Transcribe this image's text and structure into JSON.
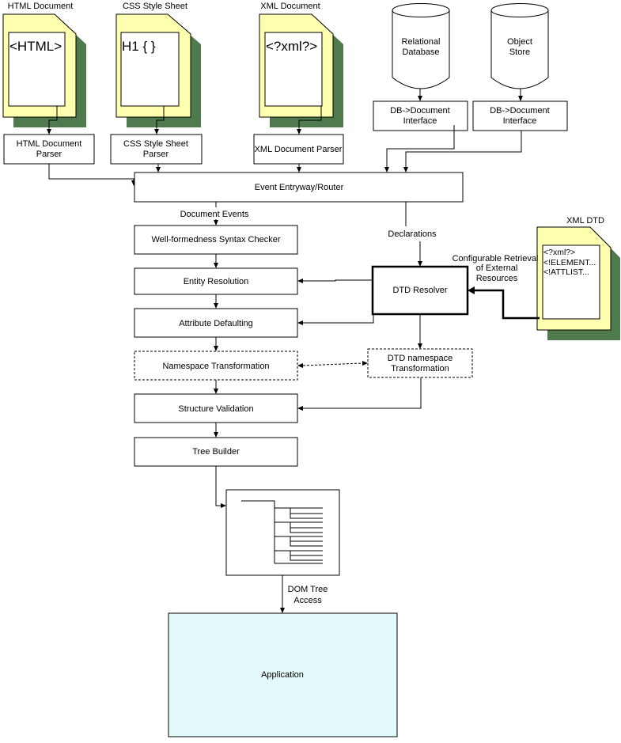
{
  "colors": {
    "page_fill": "#ffffb0",
    "shadow_fill": "#4e7a4e",
    "application_fill": "#e3f8f8",
    "stroke": "#000000"
  },
  "sources": {
    "html_doc": {
      "label": "HTML Document",
      "content": "<HTML>"
    },
    "css_doc": {
      "label": "CSS Style Sheet",
      "content": "H1 { }"
    },
    "xml_doc": {
      "label": "XML Document",
      "content": "<?xml?>"
    },
    "relational_db": {
      "lines": [
        "Relational",
        "Database"
      ]
    },
    "object_store": {
      "lines": [
        "Object",
        "Store"
      ]
    },
    "xml_dtd": {
      "label": "XML DTD",
      "lines": [
        "<?xml?>",
        "<!ELEMENT...",
        "<!ATTLIST..."
      ]
    }
  },
  "parsers": {
    "html": {
      "lines": [
        "HTML Document",
        "Parser"
      ]
    },
    "css": {
      "lines": [
        "CSS Style Sheet",
        "Parser"
      ]
    },
    "xml": {
      "label": "XML Document Parser"
    },
    "db_interface_1": {
      "lines": [
        "DB->Document",
        "Interface"
      ]
    },
    "db_interface_2": {
      "lines": [
        "DB->Document",
        "Interface"
      ]
    }
  },
  "router": {
    "label": "Event Entryway/Router"
  },
  "edges": {
    "document_events": "Document Events",
    "declarations": "Declarations",
    "external_retrieval": [
      "Configurable Retrieval",
      "of External",
      "Resources"
    ],
    "dom_access": [
      "DOM Tree",
      "Access"
    ]
  },
  "pipeline": [
    {
      "label": "Well-formedness Syntax Checker"
    },
    {
      "label": "Entity Resolution"
    },
    {
      "label": "Attribute Defaulting"
    },
    {
      "label": "Namespace Transformation"
    },
    {
      "label": "Structure Validation"
    },
    {
      "label": "Tree Builder"
    }
  ],
  "dtd": {
    "resolver": "DTD Resolver",
    "namespace_transform": [
      "DTD namespace",
      "Transformation"
    ]
  },
  "application": {
    "label": "Application"
  }
}
